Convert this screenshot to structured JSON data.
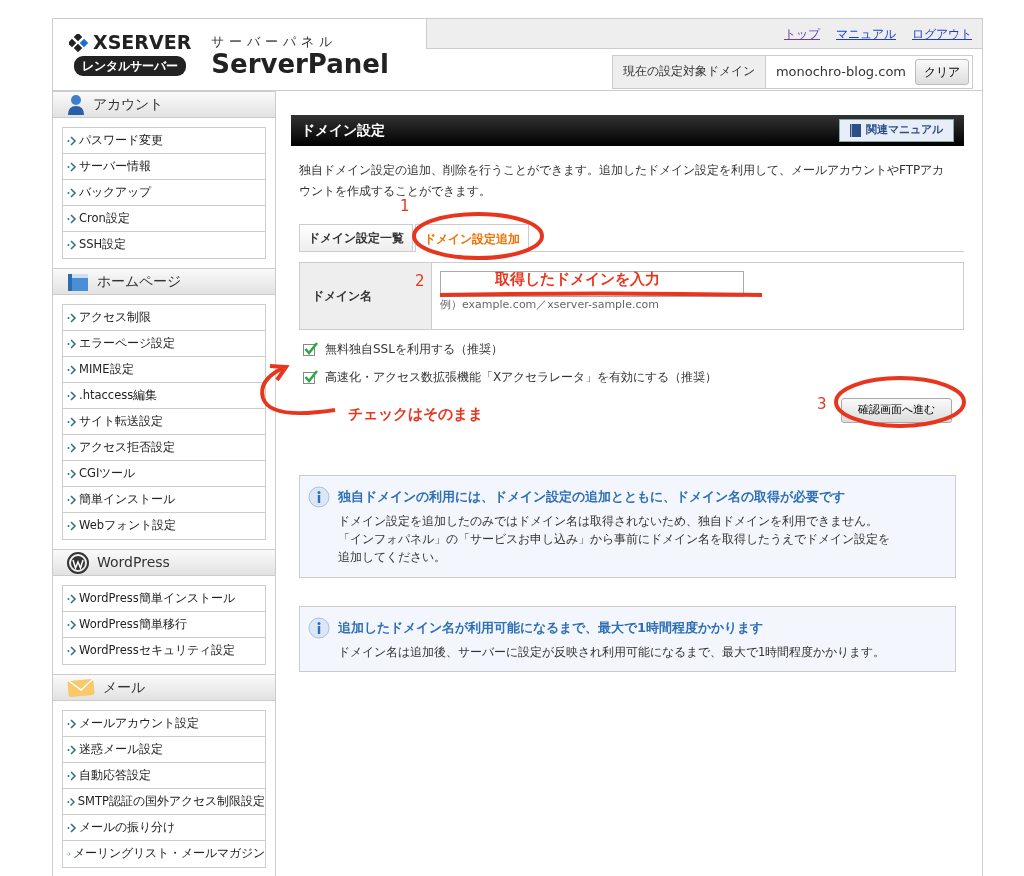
{
  "logo": {
    "brand": "XSERVER",
    "badge": "レンタルサーバー",
    "kana": "サーバーパネル",
    "product": "ServerPanel"
  },
  "top_links": [
    {
      "label": "トップ",
      "visited": true
    },
    {
      "label": "マニュアル",
      "visited": false
    },
    {
      "label": "ログアウト",
      "visited": false
    }
  ],
  "domain_bar": {
    "label": "現在の設定対象ドメイン",
    "value": "monochro-blog.com",
    "button": "クリア"
  },
  "sidebar": [
    {
      "title": "アカウント",
      "kind": "person",
      "items": [
        "パスワード変更",
        "サーバー情報",
        "バックアップ",
        "Cron設定",
        "SSH設定"
      ]
    },
    {
      "title": "ホームページ",
      "kind": "page",
      "items": [
        "アクセス制限",
        "エラーページ設定",
        "MIME設定",
        ".htaccess編集",
        "サイト転送設定",
        "アクセス拒否設定",
        "CGIツール",
        "簡単インストール",
        "Webフォント設定"
      ]
    },
    {
      "title": "WordPress",
      "kind": "circle",
      "items": [
        "WordPress簡単インストール",
        "WordPress簡単移行",
        "WordPressセキュリティ設定"
      ]
    },
    {
      "title": "メール",
      "kind": "mail",
      "items": [
        "メールアカウント設定",
        "迷惑メール設定",
        "自動応答設定",
        "SMTP認証の国外アクセス制限設定",
        "メールの振り分け",
        "メーリングリスト・メールマガジン"
      ]
    }
  ],
  "main": {
    "title": "ドメイン設定",
    "manual_button": "関連マニュアル",
    "description": "独自ドメイン設定の追加、削除を行うことができます。追加したドメイン設定を利用して、メールアカウントやFTPアカウントを作成することができます。",
    "tabs": [
      {
        "label": "ドメイン設定一覧",
        "selected": false
      },
      {
        "label": "ドメイン設定追加",
        "selected": true
      }
    ],
    "form": {
      "label": "ドメイン名",
      "hint": "例）example.com／xserver-sample.com"
    },
    "options": [
      {
        "label": "無料独自SSLを利用する（推奨）",
        "checked": true
      },
      {
        "label": "高速化・アクセス数拡張機能「Xアクセラレータ」を有効にする（推奨）",
        "checked": true
      }
    ],
    "submit": "確認画面へ進む",
    "notices": [
      {
        "title": "独自ドメインの利用には、ドメイン設定の追加とともに、ドメイン名の取得が必要です",
        "lines": [
          "ドメイン設定を追加したのみではドメイン名は取得されないため、独自ドメインを利用できません。",
          "「インフォパネル」の「サービスお申し込み」から事前にドメイン名を取得したうえでドメイン設定を",
          "追加してください。"
        ]
      },
      {
        "title": "追加したドメイン名が利用可能になるまで、最大で1時間程度かかります",
        "lines": [
          "ドメイン名は追加後、サーバーに設定が反映され利用可能になるまで、最大で1時間程度かかります。"
        ]
      }
    ]
  },
  "annotations": [
    {
      "kind": "number",
      "text": "1"
    },
    {
      "kind": "number",
      "text": "2"
    },
    {
      "kind": "note",
      "text": "取得したドメインを入力"
    },
    {
      "kind": "note",
      "text": "チェックはそのまま"
    },
    {
      "kind": "number",
      "text": "3"
    }
  ]
}
